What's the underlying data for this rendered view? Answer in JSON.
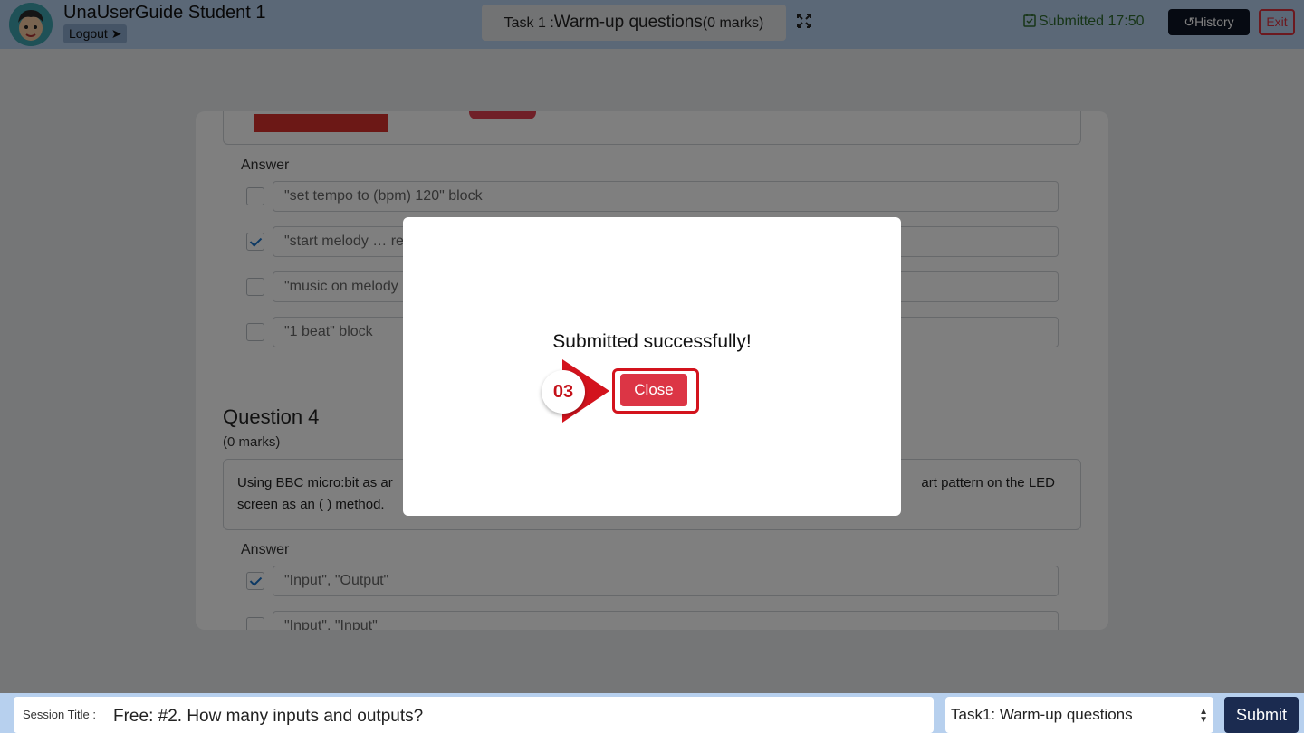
{
  "header": {
    "user_name": "UnaUserGuide Student 1",
    "logout_label": "Logout",
    "task_prefix": "Task 1 :",
    "task_name": "Warm-up questions",
    "task_marks": "(0 marks)",
    "submitted_label": "Submitted 17:50",
    "history_label": "History",
    "exit_label": "Exit"
  },
  "question3": {
    "answer_label": "Answer",
    "options": [
      {
        "text": "\"set tempo to (bpm) 120\"  block",
        "checked": false
      },
      {
        "text": "\"start melody … re",
        "checked": true
      },
      {
        "text": "\"music on melody",
        "checked": false
      },
      {
        "text": "\"1 beat\" block",
        "checked": false
      }
    ]
  },
  "question4": {
    "title": "Question 4",
    "marks": "(0 marks)",
    "text_left": "Using BBC micro:bit as ar",
    "text_right": "art pattern on the LED",
    "text_line2": "screen as an ( ) method.",
    "answer_label": "Answer",
    "options": [
      {
        "text": "\"Input\", \"Output\"",
        "checked": true
      },
      {
        "text": "\"Input\", \"Input\"",
        "checked": false
      }
    ]
  },
  "modal": {
    "message": "Submitted successfully!",
    "close_label": "Close",
    "step_number": "03"
  },
  "footer": {
    "session_label": "Session Title :",
    "session_value": "Free: #2. How many inputs and outputs?",
    "task_select_value": "Task1: Warm-up questions",
    "submit_label": "Submit"
  },
  "colors": {
    "header_bg": "#b7d0ee",
    "close_button": "#dc3545",
    "highlight": "#d3131d",
    "submit_button": "#1b2b50"
  }
}
